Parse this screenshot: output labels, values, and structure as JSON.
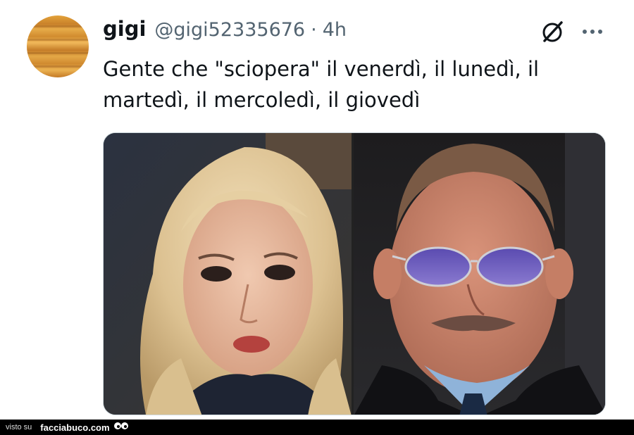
{
  "tweet": {
    "author_name": "gigi",
    "author_handle": "@gigi52335676",
    "separator": "·",
    "time_ago": "4h",
    "text_line1": "Gente che \"sciopera\" il venerdì, il lunedì, il",
    "text_line2": "martedì, il mercoledì, il giovedì",
    "icons": [
      "grok-icon",
      "more-icon"
    ],
    "media": [
      "blonde-woman-photo",
      "elderly-man-sunglasses-photo"
    ]
  },
  "footer": {
    "visto_su": "visto su",
    "site": "facciabuco.com"
  },
  "colors": {
    "text": "#0f1419",
    "secondary": "#536471",
    "border": "#cfd9de",
    "footer_bg": "#000000"
  }
}
